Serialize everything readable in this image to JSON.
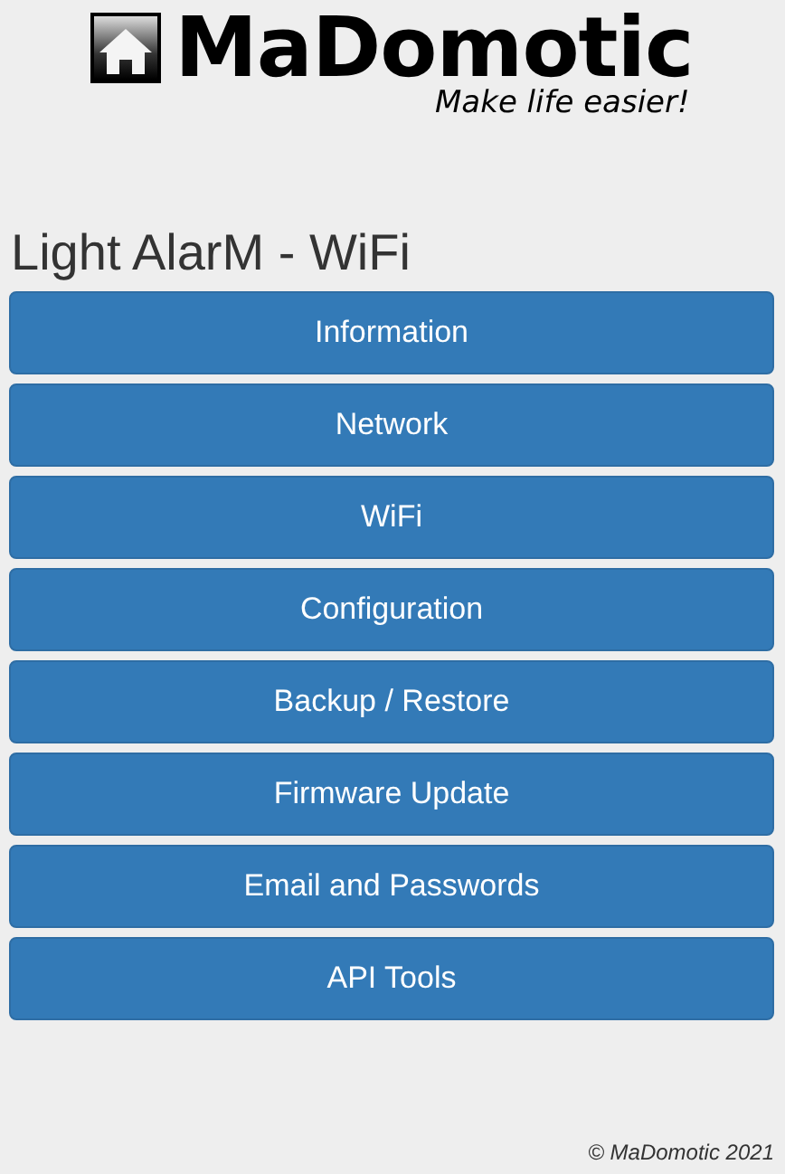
{
  "logo": {
    "name": "MaDomotic",
    "tagline": "Make life easier!"
  },
  "title": "Light AlarM - WiFi",
  "buttons": [
    "Information",
    "Network",
    "WiFi",
    "Configuration",
    "Backup / Restore",
    "Firmware Update",
    "Email and Passwords",
    "API Tools"
  ],
  "footer": "© MaDomotic 2021"
}
